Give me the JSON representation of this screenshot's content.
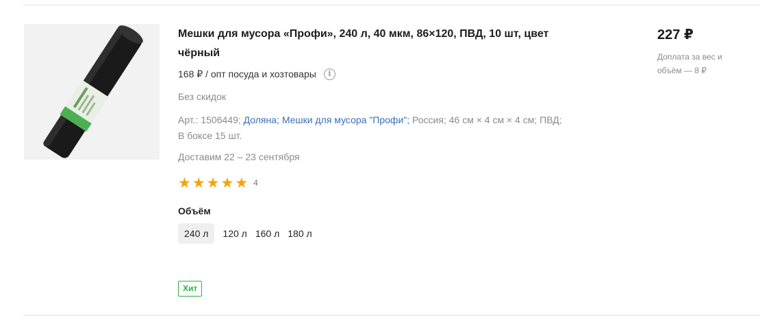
{
  "product": {
    "title": "Мешки для мусора «Профи», 240 л, 40 мкм, 86×120, ПВД, 10 шт, цвет чёрный",
    "wholesale_price": "168 ₽ / опт посуда и хозтовары",
    "discount": "Без скидок",
    "meta": {
      "article": "Арт.: 1506449;",
      "brand": "Доляна;",
      "series": "Мешки для мусора \"Профи\";",
      "country": "Россия;",
      "size": "46 см × 4 см × 4 см;",
      "material": "ПВД;",
      "box": "В боксе 15 шт."
    },
    "delivery": "Доставим 22 – 23 сентября",
    "rating": {
      "stars": 5,
      "count": "4"
    },
    "volume": {
      "label": "Объём",
      "options": [
        "240 л",
        "120 л",
        "160 л",
        "180 л"
      ],
      "selected": "240 л"
    },
    "badge": "Хит",
    "price": "227 ₽",
    "surcharge": "Доплата за вес и объём — 8 ₽"
  },
  "colors": {
    "accent_link": "#3a6fb5",
    "star": "#f5a400",
    "badge_green": "#2bb046"
  },
  "icons": {
    "info": "info-icon",
    "star": "star-icon"
  }
}
